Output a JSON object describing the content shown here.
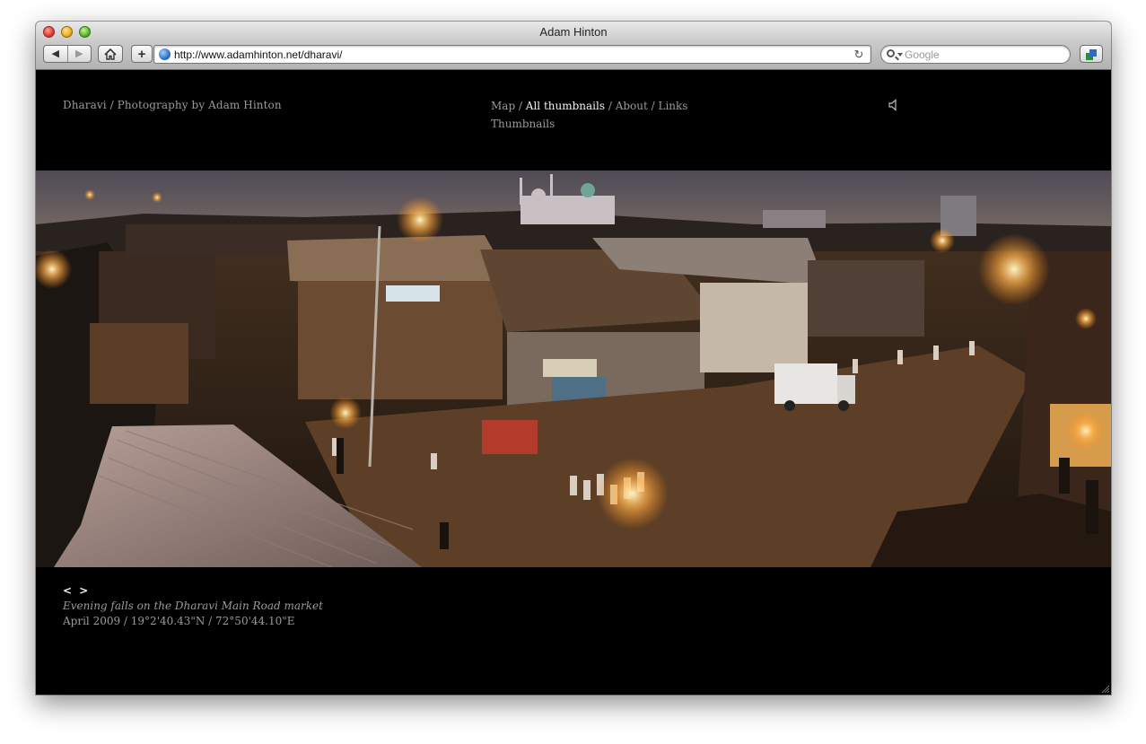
{
  "window": {
    "title": "Adam Hinton"
  },
  "toolbar": {
    "back_label": "◀",
    "forward_label": "▶",
    "home_label": "⌂",
    "add_label": "+",
    "url": "http://www.adamhinton.net/dharavi/",
    "reload_label": "↻",
    "search_placeholder": "Google"
  },
  "page": {
    "site_title": "Dharavi / Photography by Adam Hinton",
    "menu": {
      "items": [
        {
          "label": "Map",
          "active": false
        },
        {
          "label": "All thumbnails",
          "active": true
        },
        {
          "label": "About",
          "active": false
        },
        {
          "label": "Links",
          "active": false
        }
      ],
      "separator": " / ",
      "second_line": "Thumbnails"
    },
    "pager": {
      "prev_label": "<",
      "next_label": ">"
    },
    "caption": "Evening falls on the Dharavi Main Road market",
    "caption_meta": "April 2009 / 19°2'40.43\"N / 72°50'44.10\"E"
  },
  "colors": {
    "page_bg": "#000000",
    "text_muted": "#9a9a9a",
    "text_active": "#f2f2f2"
  },
  "icons": {
    "speaker": "speaker-icon",
    "globe": "globe-icon",
    "search": "search-icon"
  }
}
